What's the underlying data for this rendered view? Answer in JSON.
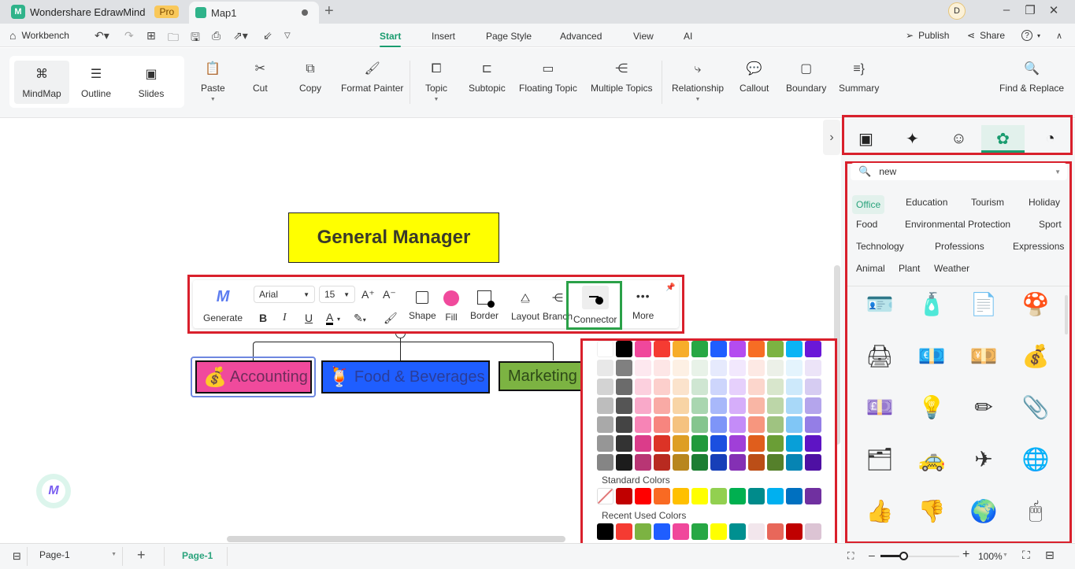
{
  "titlebar": {
    "app_name": "Wondershare EdrawMind",
    "pro_badge": "Pro",
    "doc_tab": "Map1",
    "new_tab": "+",
    "avatar": "D",
    "minimize": "–",
    "restore": "❐",
    "close": "✕"
  },
  "menubar": {
    "workbench": "Workbench",
    "menus": [
      "Start",
      "Insert",
      "Page Style",
      "Advanced",
      "View",
      "AI"
    ],
    "active_menu": "Start",
    "publish": "Publish",
    "share": "Share",
    "help": "?"
  },
  "ribbon": {
    "views": [
      "MindMap",
      "Outline",
      "Slides"
    ],
    "selected_view": "MindMap",
    "clipboard": [
      "Paste",
      "Cut",
      "Copy",
      "Format Painter"
    ],
    "insert": [
      "Topic",
      "Subtopic",
      "Floating Topic",
      "Multiple Topics"
    ],
    "elements": [
      "Relationship",
      "Callout",
      "Boundary",
      "Summary"
    ],
    "find_replace": "Find & Replace"
  },
  "canvas": {
    "root_topic": "General Manager",
    "topics": [
      {
        "label": "Accounting",
        "icon": "money-bag",
        "fill": "#f04a9c"
      },
      {
        "label": "Food & Beverages",
        "icon": "cocktail",
        "fill": "#1f5eff"
      },
      {
        "label": "Marketing",
        "icon": "",
        "fill": "#7cb342"
      }
    ],
    "root_fill": "#ffff00",
    "selected_topic": "Accounting"
  },
  "floating_toolbar": {
    "generate": "Generate",
    "font": "Arial",
    "font_size": "15",
    "grow": "A⁺",
    "shrink": "A⁻",
    "bold": "B",
    "italic": "I",
    "underline": "U",
    "font_color": "A",
    "shape": "Shape",
    "fill": "Fill",
    "fill_color": "#f04a9c",
    "border": "Border",
    "layout": "Layout",
    "branch": "Branch",
    "connector": "Connector",
    "more": "More"
  },
  "color_picker": {
    "theme_rows": [
      [
        "#ffffff",
        "#000000",
        "#f0479b",
        "#f53b32",
        "#f7ad2a",
        "#27a744",
        "#1f5eff",
        "#b44cf0",
        "#f76d24",
        "#7cb342",
        "#0ab4f5",
        "#6a18d8"
      ],
      [
        "#e8e8e8",
        "#808080",
        "#fde8ef",
        "#fde6e6",
        "#fdf0e4",
        "#e8f2e8",
        "#e6eafd",
        "#f2e8fd",
        "#fde9e4",
        "#ecf0e8",
        "#e4f4fd",
        "#ece4f8"
      ],
      [
        "#d3d3d3",
        "#6b6b6b",
        "#fcd0de",
        "#fccfcc",
        "#fbe3cc",
        "#cfe6d2",
        "#cdd5fc",
        "#e6d0fc",
        "#fcd6cc",
        "#d8e6cc",
        "#cde9fb",
        "#d6ccf2"
      ],
      [
        "#bdbdbd",
        "#555555",
        "#f9a9c9",
        "#f9aaa5",
        "#f8d4a5",
        "#a9d6b0",
        "#a8b8fa",
        "#d6aefa",
        "#f9b6a5",
        "#bcd6a8",
        "#a8d8f8",
        "#b4a5ec"
      ],
      [
        "#a9a9a9",
        "#444444",
        "#f784b6",
        "#f7857f",
        "#f5c27f",
        "#85c58e",
        "#7e95f8",
        "#c48cf8",
        "#f7967e",
        "#9fc381",
        "#80c6f6",
        "#947ee6"
      ],
      [
        "#969696",
        "#333333",
        "#db3c8a",
        "#dc3326",
        "#de9e24",
        "#219a3c",
        "#1b4fe0",
        "#a03fd8",
        "#e05e1c",
        "#6a9e36",
        "#089fd8",
        "#5e14c4"
      ],
      [
        "#858585",
        "#1c1c1c",
        "#b83574",
        "#b82a20",
        "#b8861e",
        "#1c7e32",
        "#173fb8",
        "#8430b4",
        "#bb4e17",
        "#55802b",
        "#0684b3",
        "#4e10a3"
      ]
    ],
    "standard_label": "Standard Colors",
    "standard_colors": [
      "none",
      "#c00000",
      "#ff0000",
      "#f96a23",
      "#ffc000",
      "#ffff00",
      "#92d050",
      "#00b050",
      "#008b8b",
      "#00b0f0",
      "#0070c0",
      "#7030a0"
    ],
    "recent_label": "Recent Used Colors",
    "recent_colors": [
      "#000000",
      "#f53b32",
      "#7cb342",
      "#1f5eff",
      "#f0479b",
      "#27a744",
      "#ffff00",
      "#009090",
      "#f2e6ec",
      "#e8675a",
      "#c00000",
      "#dcc4d4"
    ]
  },
  "right_panel": {
    "tabs": [
      "format-icon",
      "ai-sparkle-icon",
      "sticker-icon",
      "clipart-icon",
      "history-icon"
    ],
    "selected_tab": "clipart-icon",
    "search_value": "new",
    "categories": [
      "Office",
      "Education",
      "Tourism",
      "Holiday",
      "Food",
      "Environmental Protection",
      "Sport",
      "Technology",
      "Professions",
      "Expressions",
      "Animal",
      "Plant",
      "Weather"
    ],
    "selected_category": "Office",
    "icons": [
      [
        "id-badge",
        "glue-bottle",
        "resume",
        "stamp"
      ],
      [
        "printer",
        "euro-coin",
        "yen-coin",
        "dollar-bag"
      ],
      [
        "pound-bag",
        "desk-lamp",
        "pencil",
        "stapler"
      ],
      [
        "binder-clip",
        "taxi",
        "airplane",
        "globe"
      ],
      [
        "thumbs-up",
        "thumbs-down",
        "earth",
        "mouse"
      ]
    ]
  },
  "statusbar": {
    "page_select": "Page-1",
    "add_page": "+",
    "page_tab": "Page-1",
    "zoom_minus": "–",
    "zoom_plus": "+",
    "zoom_level": "100%",
    "zoom_fraction": 0.3
  }
}
